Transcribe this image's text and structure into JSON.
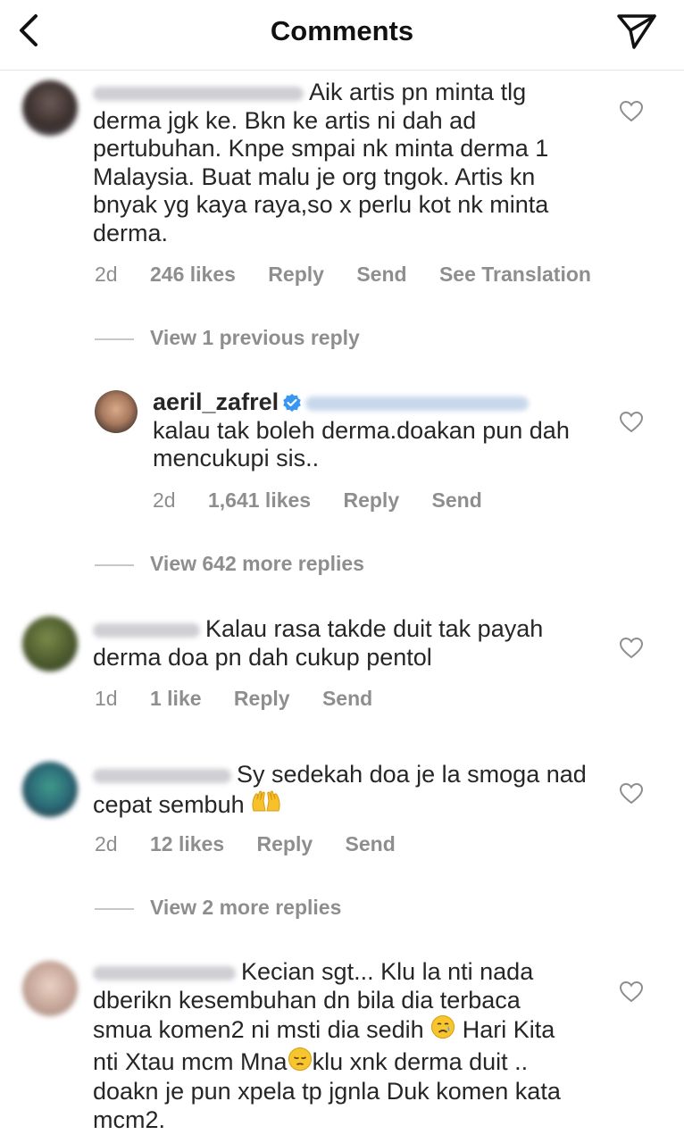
{
  "header": {
    "title": "Comments",
    "back_icon": "chevron-left-icon",
    "send_icon": "paper-plane-icon"
  },
  "comments": [
    {
      "text": "Aik artis pn minta tlg derma jgk ke. Bkn ke artis ni dah ad pertubuhan. Knpe smpai nk minta derma 1 Malaysia. Buat malu je org tngok. Artis kn bnyak yg kaya raya,so x perlu kot nk minta derma.",
      "time": "2d",
      "likes": "246 likes",
      "reply": "Reply",
      "send": "Send",
      "translation": "See Translation",
      "view_replies": "View 1 previous reply"
    },
    {
      "username": "aeril_zafrel",
      "text": "kalau tak boleh derma.doakan pun dah mencukupi sis..",
      "time": "2d",
      "likes": "1,641 likes",
      "reply": "Reply",
      "send": "Send",
      "view_replies": "View 642 more replies"
    },
    {
      "text": "Kalau rasa takde duit tak payah derma doa pn dah cukup pentol",
      "time": "1d",
      "likes": "1 like",
      "reply": "Reply",
      "send": "Send"
    },
    {
      "text": "Sy sedekah doa je la smoga nad cepat sembuh",
      "emoji": "🤲",
      "time": "2d",
      "likes": "12 likes",
      "reply": "Reply",
      "send": "Send",
      "view_replies": "View 2 more replies"
    },
    {
      "text_lines": [
        "Kecian sgt... Klu la nti nada",
        "dberikn kesembuhan dn bila dia terbaca",
        "smua komen2 ni msti dia sedih",
        "Hari Kita",
        "nti Xtau mcm Mna",
        "klu xnk derma duit ..",
        "doakn je pun xpela tp jgnla Duk komen kata",
        "mcm2."
      ],
      "emoji_cry": "😢",
      "emoji_pensive": "😔"
    }
  ],
  "colors": {
    "text": "#262626",
    "meta": "#8e8e8e",
    "verified": "#3897f0"
  }
}
